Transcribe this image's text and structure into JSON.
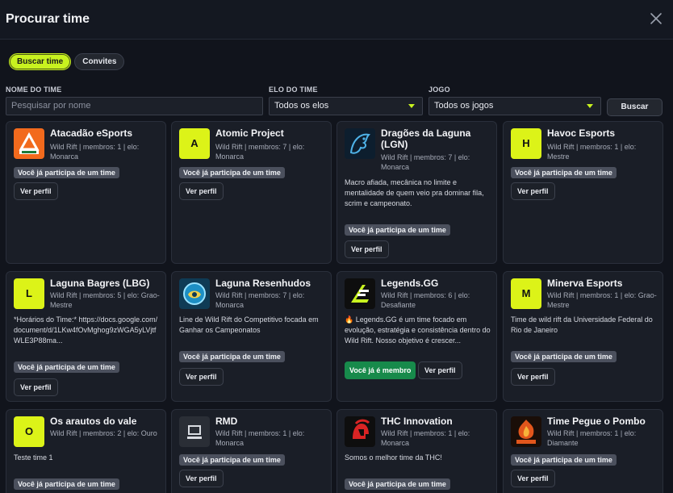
{
  "header": {
    "title": "Procurar time"
  },
  "tabs": [
    {
      "label": "Buscar time",
      "active": true
    },
    {
      "label": "Convites",
      "active": false
    }
  ],
  "filters": {
    "name_label": "NOME DO TIME",
    "name_placeholder": "Pesquisar por nome",
    "elo_label": "ELO DO TIME",
    "elo_value": "Todos os elos",
    "game_label": "JOGO",
    "game_value": "Todos os jogos",
    "search_button": "Buscar"
  },
  "accent_color": "#c8f21f",
  "badge_text": "Você já participa de um time",
  "member_text": "Você já é membro",
  "profile_text": "Ver perfil",
  "teams": [
    {
      "name": "Atacadão eSports",
      "meta": "Wild Rift | membros: 1 | elo: Monarca",
      "logo": "atacadao-logo",
      "description": ""
    },
    {
      "name": "Atomic Project",
      "meta": "Wild Rift | membros: 7 | elo: Monarca",
      "logo_letter": "A",
      "description": ""
    },
    {
      "name": "Dragões da Laguna (LGN)",
      "meta": "Wild Rift | membros: 7 | elo: Monarca",
      "logo": "dragon-logo",
      "description": "Macro afiada, mecânica no limite e mentalidade de quem veio pra dominar fila, scrim e campeonato."
    },
    {
      "name": "Havoc Esports",
      "meta": "Wild Rift | membros: 1 | elo: Mestre",
      "logo_letter": "H",
      "description": ""
    },
    {
      "name": "Laguna Bagres (LBG)",
      "meta": "Wild Rift | membros: 5 | elo: Grao-Mestre",
      "logo_letter": "L",
      "description": "*Horários do Time:* https://docs.google.com/document/d/1LKw4fOvMghog9zWGA5yLVjtfWLE3P88ma..."
    },
    {
      "name": "Laguna Resenhudos",
      "meta": "Wild Rift | membros: 7 | elo: Monarca",
      "logo": "resenhudos-logo",
      "description": "Line de Wild Rift do Competitivo focada em Ganhar os Campeonatos"
    },
    {
      "name": "Legends.GG",
      "meta": "Wild Rift | membros: 6 | elo: Desafiante",
      "logo": "legends-logo",
      "description": "🔥 Legends.GG é um time focado em evolução, estratégia e consistência dentro do Wild Rift. Nosso objetivo é crescer...",
      "is_member": true
    },
    {
      "name": "Minerva Esports",
      "meta": "Wild Rift | membros: 1 | elo: Grao-Mestre",
      "logo_letter": "M",
      "description": "Time de wild rift da Universidade Federal do Rio de Janeiro"
    },
    {
      "name": "Os arautos do vale",
      "meta": "Wild Rift | membros: 2 | elo: Ouro",
      "logo_letter": "O",
      "description": "Teste time 1"
    },
    {
      "name": "RMD",
      "meta": "Wild Rift | membros: 1 | elo: Monarca",
      "logo": "rmd-logo",
      "description": ""
    },
    {
      "name": "THC Innovation",
      "meta": "Wild Rift | membros: 1 | elo: Monarca",
      "logo": "spartan-helmet-logo",
      "description": "Somos o melhor time da THC!"
    },
    {
      "name": "Time Pegue o Pombo",
      "meta": "Wild Rift | membros: 1 | elo: Diamante",
      "logo": "pombo-logo",
      "description": ""
    }
  ]
}
